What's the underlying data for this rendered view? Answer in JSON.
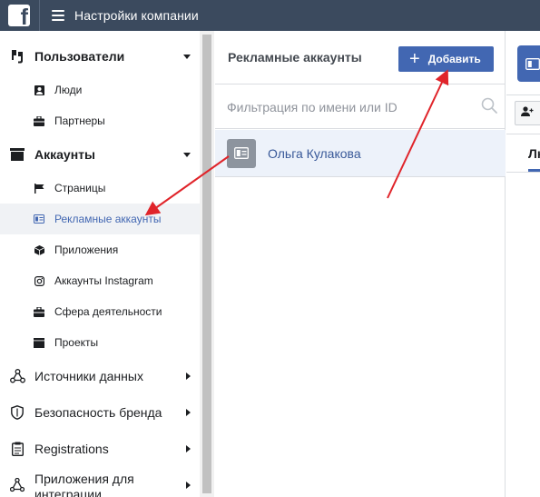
{
  "topbar": {
    "logo_letter": "f",
    "title": "Настройки компании"
  },
  "sidebar": {
    "sections": [
      {
        "label": "Пользователи",
        "icon": "users-icon",
        "expanded": true,
        "items": [
          {
            "label": "Люди",
            "icon": "person-icon"
          },
          {
            "label": "Партнеры",
            "icon": "briefcase-icon"
          }
        ]
      },
      {
        "label": "Аккаунты",
        "icon": "folder-icon",
        "expanded": true,
        "items": [
          {
            "label": "Страницы",
            "icon": "flag-icon"
          },
          {
            "label": "Рекламные аккаунты",
            "icon": "ad-account-icon",
            "active": true
          },
          {
            "label": "Приложения",
            "icon": "cube-icon"
          },
          {
            "label": "Аккаунты Instagram",
            "icon": "instagram-icon"
          },
          {
            "label": "Сфера деятельности",
            "icon": "briefcase-icon"
          },
          {
            "label": "Проекты",
            "icon": "folder-icon"
          }
        ]
      }
    ],
    "groups": [
      {
        "label": "Источники данных",
        "icon": "data-sources-icon"
      },
      {
        "label": "Безопасность бренда",
        "icon": "shield-icon"
      },
      {
        "label": "Registrations",
        "icon": "clipboard-icon"
      },
      {
        "label_line1": "Приложения для",
        "label_line2": "интеграции",
        "icon": "integration-icon"
      }
    ]
  },
  "middle": {
    "title": "Рекламные аккаунты",
    "add_button": "Добавить",
    "filter_placeholder": "Фильтрация по имени или ID",
    "accounts": [
      {
        "name": "Ольга Кулакова",
        "icon": "ad-account-icon"
      }
    ]
  },
  "right": {
    "tab_label": "Лю"
  },
  "colors": {
    "topbar": "#3b4a5e",
    "accent": "#4267b2",
    "link": "#385898",
    "arrow": "#e0242a"
  }
}
